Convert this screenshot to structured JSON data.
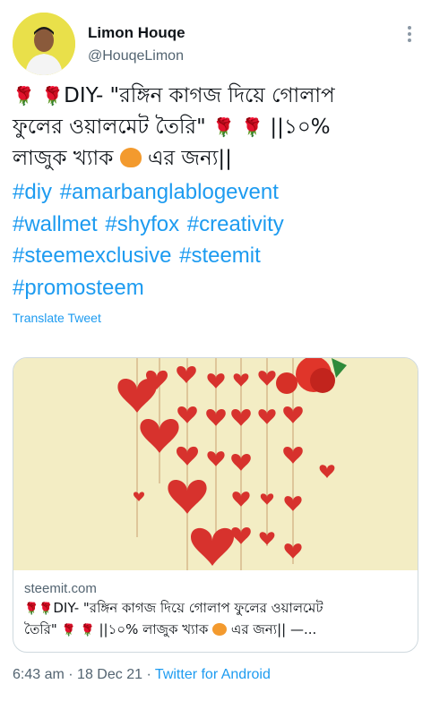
{
  "author": {
    "name": "Limon Houqe",
    "handle": "@HouqeLimon"
  },
  "tweet": {
    "text_line1": "DIY- \"রঙ্গিন কাগজ দিয়ে গোলাপ",
    "text_line2": "ফুলের ওয়ালমেট তৈরি\"",
    "text_line2b": "||১০%",
    "text_line3a": "লাজুক খ্যাক",
    "text_line3b": "এর জন্য||",
    "rose_emoji": "🌹",
    "hashtags": [
      "#diy",
      "#amarbanglablogevent",
      "#wallmet",
      "#shyfox",
      "#creativity",
      "#steemexclusive",
      "#steemit",
      "#promosteem"
    ],
    "translate_label": "Translate Tweet"
  },
  "card": {
    "domain": "steemit.com",
    "title_line1": "DIY- \"রঙ্গিন কাগজ দিয়ে গোলাপ ফুলের ওয়ালমেট",
    "title_line2a": "তৈরি\"",
    "title_line2b": "||১০% লাজুক খ্যাক",
    "title_line2c": "এর জন্য|| —..."
  },
  "meta": {
    "time": "6:43 am",
    "separator": "·",
    "date": "18 Dec 21",
    "source": "Twitter for Android"
  },
  "colors": {
    "link": "#1d9bf0",
    "secondary_text": "#536471",
    "border": "#cfd9de"
  },
  "icons": [
    "more-icon",
    "rose-emoji",
    "fox-emoji"
  ]
}
